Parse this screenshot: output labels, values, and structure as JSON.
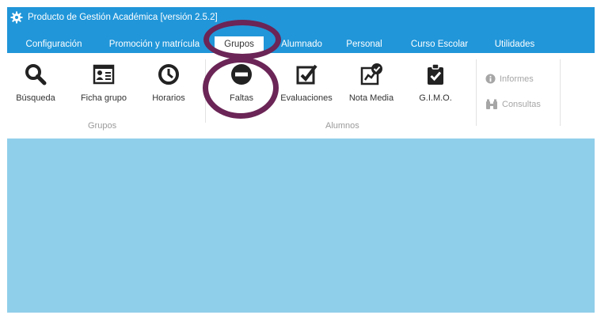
{
  "window": {
    "title": "Producto de Gestión Académica [versión 2.5.2]"
  },
  "menu": {
    "tabs": [
      {
        "label": "Configuración"
      },
      {
        "label": "Promoción y matrícula"
      },
      {
        "label": "Grupos",
        "active": true
      },
      {
        "label": "Alumnado"
      },
      {
        "label": "Personal"
      },
      {
        "label": "Curso Escolar"
      },
      {
        "label": "Utilidades"
      }
    ]
  },
  "ribbon": {
    "grupos": {
      "label": "Grupos",
      "buttons": [
        {
          "label": "Búsqueda",
          "icon": "search-icon"
        },
        {
          "label": "Ficha grupo",
          "icon": "id-card-icon"
        },
        {
          "label": "Horarios",
          "icon": "clock-icon"
        }
      ]
    },
    "alumnos": {
      "label": "Alumnos",
      "buttons": [
        {
          "label": "Faltas",
          "icon": "minus-circle-icon"
        },
        {
          "label": "Evaluaciones",
          "icon": "checkbox-icon"
        },
        {
          "label": "Nota Media",
          "icon": "chart-check-icon"
        },
        {
          "label": "G.I.M.O.",
          "icon": "clipboard-check-icon"
        }
      ]
    },
    "extra": [
      {
        "label": "Informes",
        "icon": "info-icon",
        "disabled": true
      },
      {
        "label": "Consultas",
        "icon": "binoculars-icon",
        "disabled": true
      }
    ]
  },
  "colors": {
    "header": "#2196d9",
    "content": "#90cfea",
    "highlight": "#6b2556"
  }
}
